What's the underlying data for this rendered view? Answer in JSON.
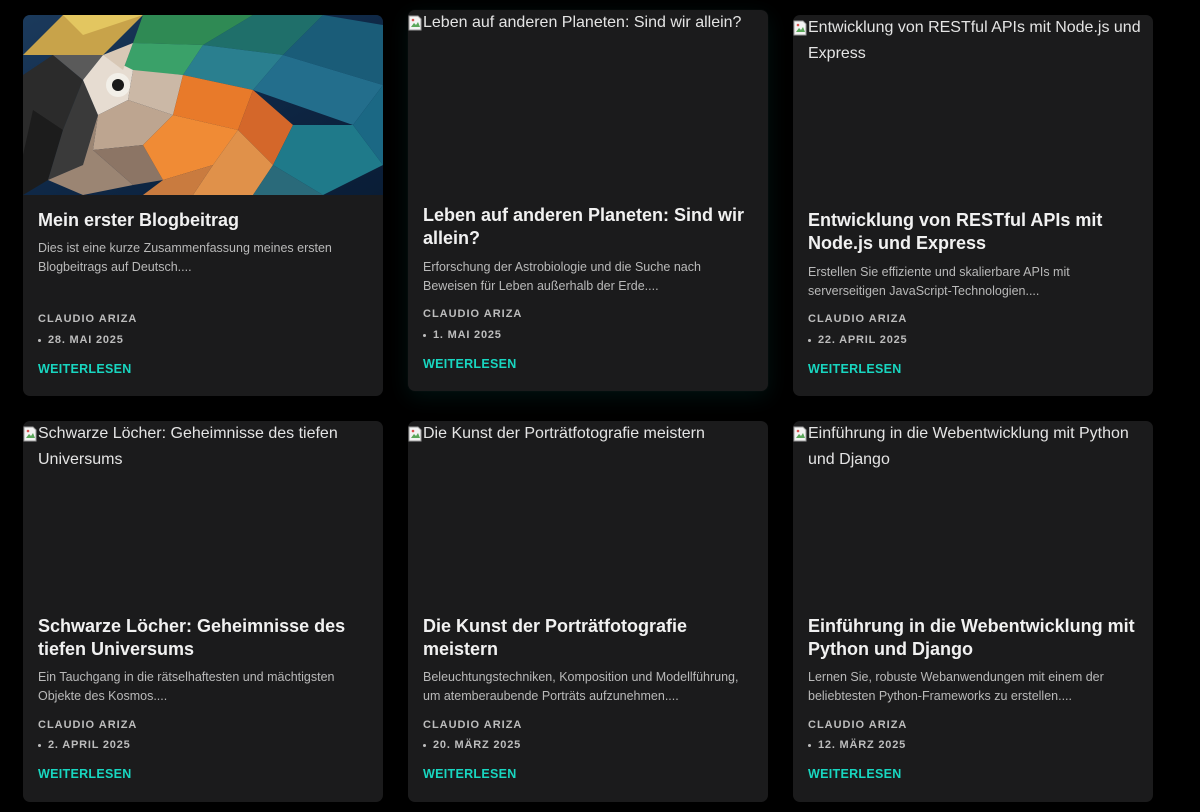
{
  "colors": {
    "page_background": "#000000",
    "card_background": "#1b1b1c",
    "accent": "#18d6c0",
    "title_text": "#f1f1f1",
    "muted_text": "#b9b9b9"
  },
  "posts": [
    {
      "image_alt": "",
      "image_kind": "low-poly-parrot",
      "title": "Mein erster Blogbeitrag",
      "excerpt": "Dies ist eine kurze Zusammenfassung meines ersten Blogbeitrags auf Deutsch....",
      "author": "CLAUDIO ARIZA",
      "date": "28. MAI 2025",
      "read_more": "WEITERLESEN"
    },
    {
      "image_alt": "Leben auf anderen Planeten: Sind wir allein?",
      "image_kind": "broken-image",
      "title": "Leben auf anderen Planeten: Sind wir allein?",
      "excerpt": "Erforschung der Astrobiologie und die Suche nach Beweisen für Leben außerhalb der Erde....",
      "author": "CLAUDIO ARIZA",
      "date": "1. MAI 2025",
      "read_more": "WEITERLESEN"
    },
    {
      "image_alt": "Entwicklung von RESTful APIs mit Node.js und Express",
      "image_kind": "broken-image",
      "title": "Entwicklung von RESTful APIs mit Node.js und Express",
      "excerpt": "Erstellen Sie effiziente und skalierbare APIs mit serverseitigen JavaScript-Technologien....",
      "author": "CLAUDIO ARIZA",
      "date": "22. APRIL 2025",
      "read_more": "WEITERLESEN"
    },
    {
      "image_alt": "Schwarze Löcher: Geheimnisse des tiefen Universums",
      "image_kind": "broken-image",
      "title": "Schwarze Löcher: Geheimnisse des tiefen Universums",
      "excerpt": "Ein Tauchgang in die rätselhaftesten und mächtigsten Objekte des Kosmos....",
      "author": "CLAUDIO ARIZA",
      "date": "2. APRIL 2025",
      "read_more": "WEITERLESEN"
    },
    {
      "image_alt": "Die Kunst der Porträtfotografie meistern",
      "image_kind": "broken-image",
      "title": "Die Kunst der Porträtfotografie meistern",
      "excerpt": "Beleuchtungstechniken, Komposition und Modellführung, um atemberaubende Porträts aufzunehmen....",
      "author": "CLAUDIO ARIZA",
      "date": "20. MÄRZ 2025",
      "read_more": "WEITERLESEN"
    },
    {
      "image_alt": "Einführung in die Webentwicklung mit Python und Django",
      "image_kind": "broken-image",
      "title": "Einführung in die Webentwicklung mit Python und Django",
      "excerpt": "Lernen Sie, robuste Webanwendungen mit einem der beliebtesten Python-Frameworks zu erstellen....",
      "author": "CLAUDIO ARIZA",
      "date": "12. MÄRZ 2025",
      "read_more": "WEITERLESEN"
    }
  ]
}
